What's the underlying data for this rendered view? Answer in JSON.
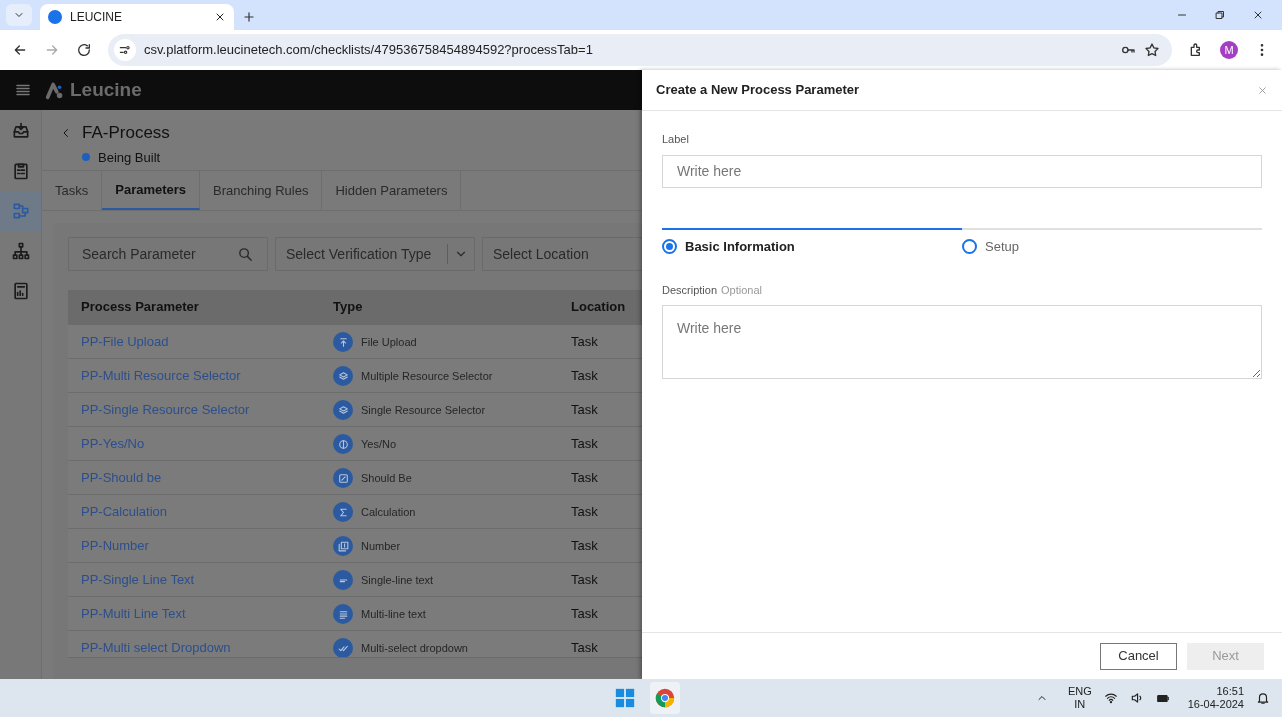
{
  "browser": {
    "tab_title": "LEUCINE",
    "url": "csv.platform.leucinetech.com/checklists/479536758454894592?processTab=1",
    "profile": "M"
  },
  "app": {
    "brand": "Leucine",
    "sidebar": [
      {
        "kind": "inbox",
        "selected": false
      },
      {
        "kind": "checklist",
        "selected": false
      },
      {
        "kind": "process",
        "selected": true
      },
      {
        "kind": "hierarchy",
        "selected": false
      },
      {
        "kind": "report",
        "selected": false
      }
    ],
    "process": {
      "title": "FA-Process",
      "status": "Being Built"
    },
    "tabs": [
      {
        "label": "Tasks",
        "selected": false
      },
      {
        "label": "Parameters",
        "selected": true
      },
      {
        "label": "Branching Rules",
        "selected": false
      },
      {
        "label": "Hidden Parameters",
        "selected": false
      }
    ],
    "filters": {
      "search_placeholder": "Search Parameter",
      "verification_placeholder": "Select Verification Type",
      "location_placeholder": "Select Location"
    },
    "table": {
      "columns": [
        "Process Parameter",
        "Type",
        "Location"
      ],
      "rows": [
        {
          "name": "PP-File Upload",
          "type": "File Upload",
          "kind": "upload",
          "location": "Task"
        },
        {
          "name": "PP-Multi Resource Selector",
          "type": "Multiple Resource Selector",
          "kind": "layers",
          "location": "Task"
        },
        {
          "name": "PP-Single Resource Selector",
          "type": "Single Resource Selector",
          "kind": "layers",
          "location": "Task"
        },
        {
          "name": "PP-Yes/No",
          "type": "Yes/No",
          "kind": "yesno",
          "location": "Task"
        },
        {
          "name": "PP-Should be",
          "type": "Should Be",
          "kind": "shouldbe",
          "location": "Task"
        },
        {
          "name": "PP-Calculation",
          "type": "Calculation",
          "kind": "sigma",
          "location": "Task"
        },
        {
          "name": "PP-Number",
          "type": "Number",
          "kind": "number",
          "location": "Task"
        },
        {
          "name": "PP-Single Line Text",
          "type": "Single-line text",
          "kind": "singleline",
          "location": "Task"
        },
        {
          "name": "PP-Multi Line Text",
          "type": "Multi-line text",
          "kind": "multiline",
          "location": "Task"
        },
        {
          "name": "PP-Multi select Dropdown",
          "type": "Multi-select dropdown",
          "kind": "multiselect",
          "location": "Task"
        }
      ]
    }
  },
  "drawer": {
    "title": "Create a New Process Parameter",
    "label_field": {
      "label": "Label",
      "placeholder": "Write here"
    },
    "steps": [
      {
        "label": "Basic Information",
        "selected": true
      },
      {
        "label": "Setup",
        "selected": false
      }
    ],
    "description": {
      "label": "Description",
      "hint": "Optional",
      "placeholder": "Write here"
    },
    "buttons": [
      {
        "label": "Cancel",
        "kind": "secondary"
      },
      {
        "label": "Next",
        "kind": "disabled"
      }
    ]
  },
  "taskbar": {
    "language": "ENG",
    "region": "IN",
    "time": "16:51",
    "date": "16-04-2024"
  }
}
